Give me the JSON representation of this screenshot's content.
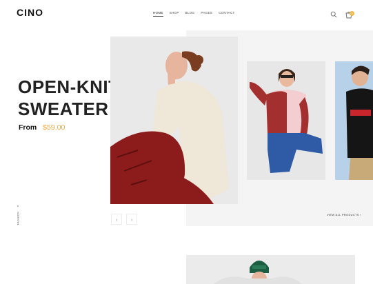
{
  "header": {
    "logo": "CINO",
    "nav": [
      "HOME",
      "SHOP",
      "BLOG",
      "PAGES",
      "CONTACT"
    ],
    "cart_count": "0"
  },
  "hero": {
    "title": "OPEN-KNIT\nSWEATER",
    "price_label": "From",
    "price_value": "$59.00",
    "view_all": "VIEW ALL PRODUCTS",
    "side_label": "FASHION"
  },
  "colors": {
    "accent": "#f0a93e",
    "badge": "#f0b74a",
    "hero_bg": "#f4f4f4"
  },
  "icons": [
    "search-icon",
    "cart-icon",
    "chevron-left-icon",
    "chevron-right-icon",
    "arrow-right-icon"
  ]
}
